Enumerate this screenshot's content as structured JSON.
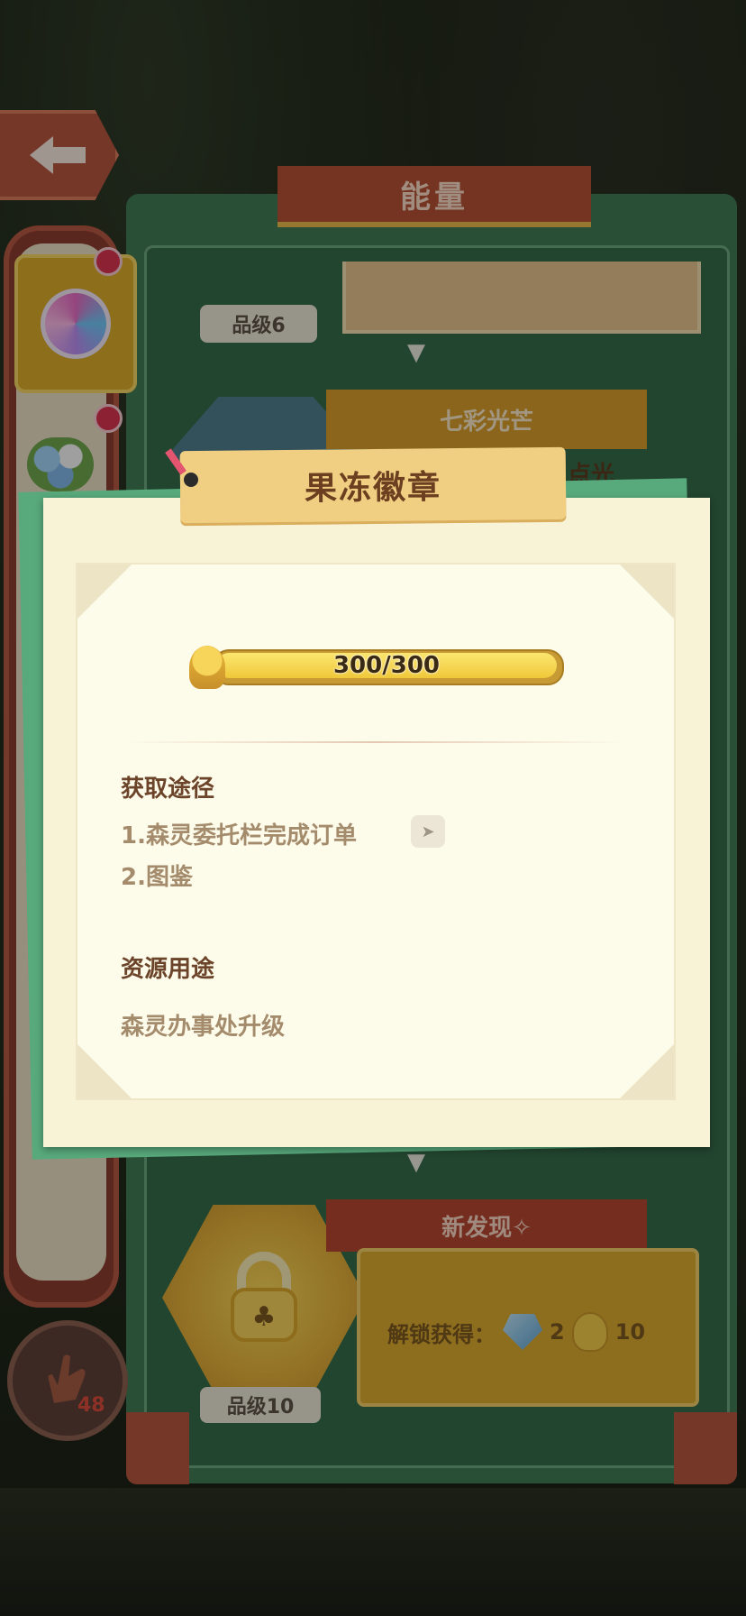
{
  "panel": {
    "title": "能量",
    "top_grade": "品级6",
    "rainbow_tab": "七彩光芒",
    "partial_text": "点光",
    "new_tab": "新发现✧",
    "unlock_label": "解锁获得：",
    "gem_count": "2",
    "coin_count": "10",
    "bottom_grade": "品级10"
  },
  "hand": {
    "count": "48"
  },
  "modal": {
    "title": "果冻徽章",
    "progress": {
      "text": "300/300",
      "fraction": 1.0
    },
    "obtain_title": "获取途径",
    "obtain_items": [
      "1.森灵委托栏完成订单",
      "2.图鉴"
    ],
    "usage_title": "资源用途",
    "usage_text": "森灵办事处升级"
  },
  "colors": {
    "panel_green": "#3f7c55",
    "title_red": "#b45035",
    "modal_bg": "#f8f2d6",
    "section_brown": "#6b4429",
    "text_muted": "#a48b6c"
  }
}
